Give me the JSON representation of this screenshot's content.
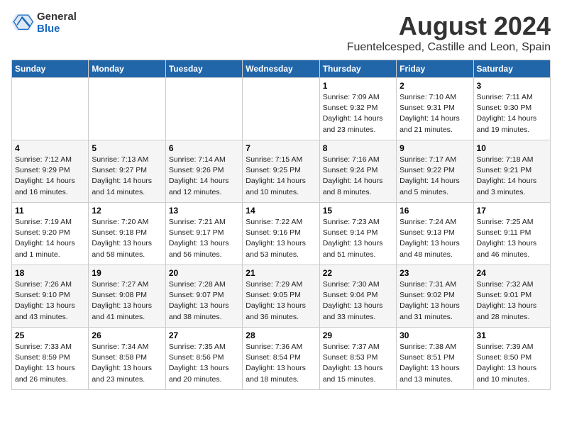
{
  "logo": {
    "general": "General",
    "blue": "Blue"
  },
  "title": "August 2024",
  "subtitle": "Fuentelcesped, Castille and Leon, Spain",
  "headers": [
    "Sunday",
    "Monday",
    "Tuesday",
    "Wednesday",
    "Thursday",
    "Friday",
    "Saturday"
  ],
  "weeks": [
    [
      {
        "day": "",
        "info": ""
      },
      {
        "day": "",
        "info": ""
      },
      {
        "day": "",
        "info": ""
      },
      {
        "day": "",
        "info": ""
      },
      {
        "day": "1",
        "info": "Sunrise: 7:09 AM\nSunset: 9:32 PM\nDaylight: 14 hours and 23 minutes."
      },
      {
        "day": "2",
        "info": "Sunrise: 7:10 AM\nSunset: 9:31 PM\nDaylight: 14 hours and 21 minutes."
      },
      {
        "day": "3",
        "info": "Sunrise: 7:11 AM\nSunset: 9:30 PM\nDaylight: 14 hours and 19 minutes."
      }
    ],
    [
      {
        "day": "4",
        "info": "Sunrise: 7:12 AM\nSunset: 9:29 PM\nDaylight: 14 hours and 16 minutes."
      },
      {
        "day": "5",
        "info": "Sunrise: 7:13 AM\nSunset: 9:27 PM\nDaylight: 14 hours and 14 minutes."
      },
      {
        "day": "6",
        "info": "Sunrise: 7:14 AM\nSunset: 9:26 PM\nDaylight: 14 hours and 12 minutes."
      },
      {
        "day": "7",
        "info": "Sunrise: 7:15 AM\nSunset: 9:25 PM\nDaylight: 14 hours and 10 minutes."
      },
      {
        "day": "8",
        "info": "Sunrise: 7:16 AM\nSunset: 9:24 PM\nDaylight: 14 hours and 8 minutes."
      },
      {
        "day": "9",
        "info": "Sunrise: 7:17 AM\nSunset: 9:22 PM\nDaylight: 14 hours and 5 minutes."
      },
      {
        "day": "10",
        "info": "Sunrise: 7:18 AM\nSunset: 9:21 PM\nDaylight: 14 hours and 3 minutes."
      }
    ],
    [
      {
        "day": "11",
        "info": "Sunrise: 7:19 AM\nSunset: 9:20 PM\nDaylight: 14 hours and 1 minute."
      },
      {
        "day": "12",
        "info": "Sunrise: 7:20 AM\nSunset: 9:18 PM\nDaylight: 13 hours and 58 minutes."
      },
      {
        "day": "13",
        "info": "Sunrise: 7:21 AM\nSunset: 9:17 PM\nDaylight: 13 hours and 56 minutes."
      },
      {
        "day": "14",
        "info": "Sunrise: 7:22 AM\nSunset: 9:16 PM\nDaylight: 13 hours and 53 minutes."
      },
      {
        "day": "15",
        "info": "Sunrise: 7:23 AM\nSunset: 9:14 PM\nDaylight: 13 hours and 51 minutes."
      },
      {
        "day": "16",
        "info": "Sunrise: 7:24 AM\nSunset: 9:13 PM\nDaylight: 13 hours and 48 minutes."
      },
      {
        "day": "17",
        "info": "Sunrise: 7:25 AM\nSunset: 9:11 PM\nDaylight: 13 hours and 46 minutes."
      }
    ],
    [
      {
        "day": "18",
        "info": "Sunrise: 7:26 AM\nSunset: 9:10 PM\nDaylight: 13 hours and 43 minutes."
      },
      {
        "day": "19",
        "info": "Sunrise: 7:27 AM\nSunset: 9:08 PM\nDaylight: 13 hours and 41 minutes."
      },
      {
        "day": "20",
        "info": "Sunrise: 7:28 AM\nSunset: 9:07 PM\nDaylight: 13 hours and 38 minutes."
      },
      {
        "day": "21",
        "info": "Sunrise: 7:29 AM\nSunset: 9:05 PM\nDaylight: 13 hours and 36 minutes."
      },
      {
        "day": "22",
        "info": "Sunrise: 7:30 AM\nSunset: 9:04 PM\nDaylight: 13 hours and 33 minutes."
      },
      {
        "day": "23",
        "info": "Sunrise: 7:31 AM\nSunset: 9:02 PM\nDaylight: 13 hours and 31 minutes."
      },
      {
        "day": "24",
        "info": "Sunrise: 7:32 AM\nSunset: 9:01 PM\nDaylight: 13 hours and 28 minutes."
      }
    ],
    [
      {
        "day": "25",
        "info": "Sunrise: 7:33 AM\nSunset: 8:59 PM\nDaylight: 13 hours and 26 minutes."
      },
      {
        "day": "26",
        "info": "Sunrise: 7:34 AM\nSunset: 8:58 PM\nDaylight: 13 hours and 23 minutes."
      },
      {
        "day": "27",
        "info": "Sunrise: 7:35 AM\nSunset: 8:56 PM\nDaylight: 13 hours and 20 minutes."
      },
      {
        "day": "28",
        "info": "Sunrise: 7:36 AM\nSunset: 8:54 PM\nDaylight: 13 hours and 18 minutes."
      },
      {
        "day": "29",
        "info": "Sunrise: 7:37 AM\nSunset: 8:53 PM\nDaylight: 13 hours and 15 minutes."
      },
      {
        "day": "30",
        "info": "Sunrise: 7:38 AM\nSunset: 8:51 PM\nDaylight: 13 hours and 13 minutes."
      },
      {
        "day": "31",
        "info": "Sunrise: 7:39 AM\nSunset: 8:50 PM\nDaylight: 13 hours and 10 minutes."
      }
    ]
  ]
}
